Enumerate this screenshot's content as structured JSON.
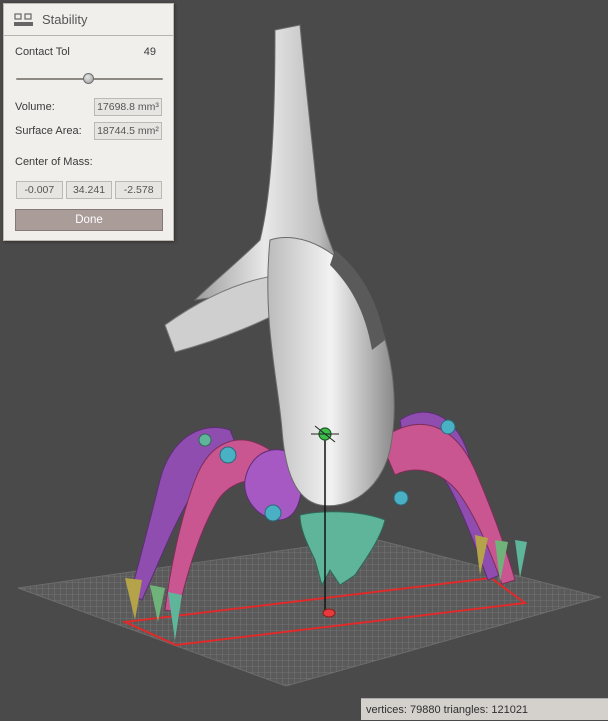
{
  "panel": {
    "title": "Stability",
    "icon": "stability-icon",
    "contact_tol_label": "Contact Tol",
    "contact_tol_value": "49",
    "slider_fraction": 0.49,
    "volume_label": "Volume:",
    "volume_value": "17698.8 mm³",
    "surface_area_label": "Surface Area:",
    "surface_area_value": "18744.5 mm²",
    "center_of_mass_label": "Center of Mass:",
    "com_x": "-0.007",
    "com_y": "34.241",
    "com_z": "-2.578",
    "done_label": "Done"
  },
  "status": {
    "text": "vertices: 79880 triangles: 121021"
  },
  "colors": {
    "viewport_bg": "#4a4a4a",
    "body_shell": "#d8d8d8",
    "legs_purple": "#9a52b8",
    "legs_pink": "#c9558f",
    "joints_cyan": "#4ab0c4",
    "base_green": "#5fb59a",
    "support_outline": "#e02a2a"
  }
}
